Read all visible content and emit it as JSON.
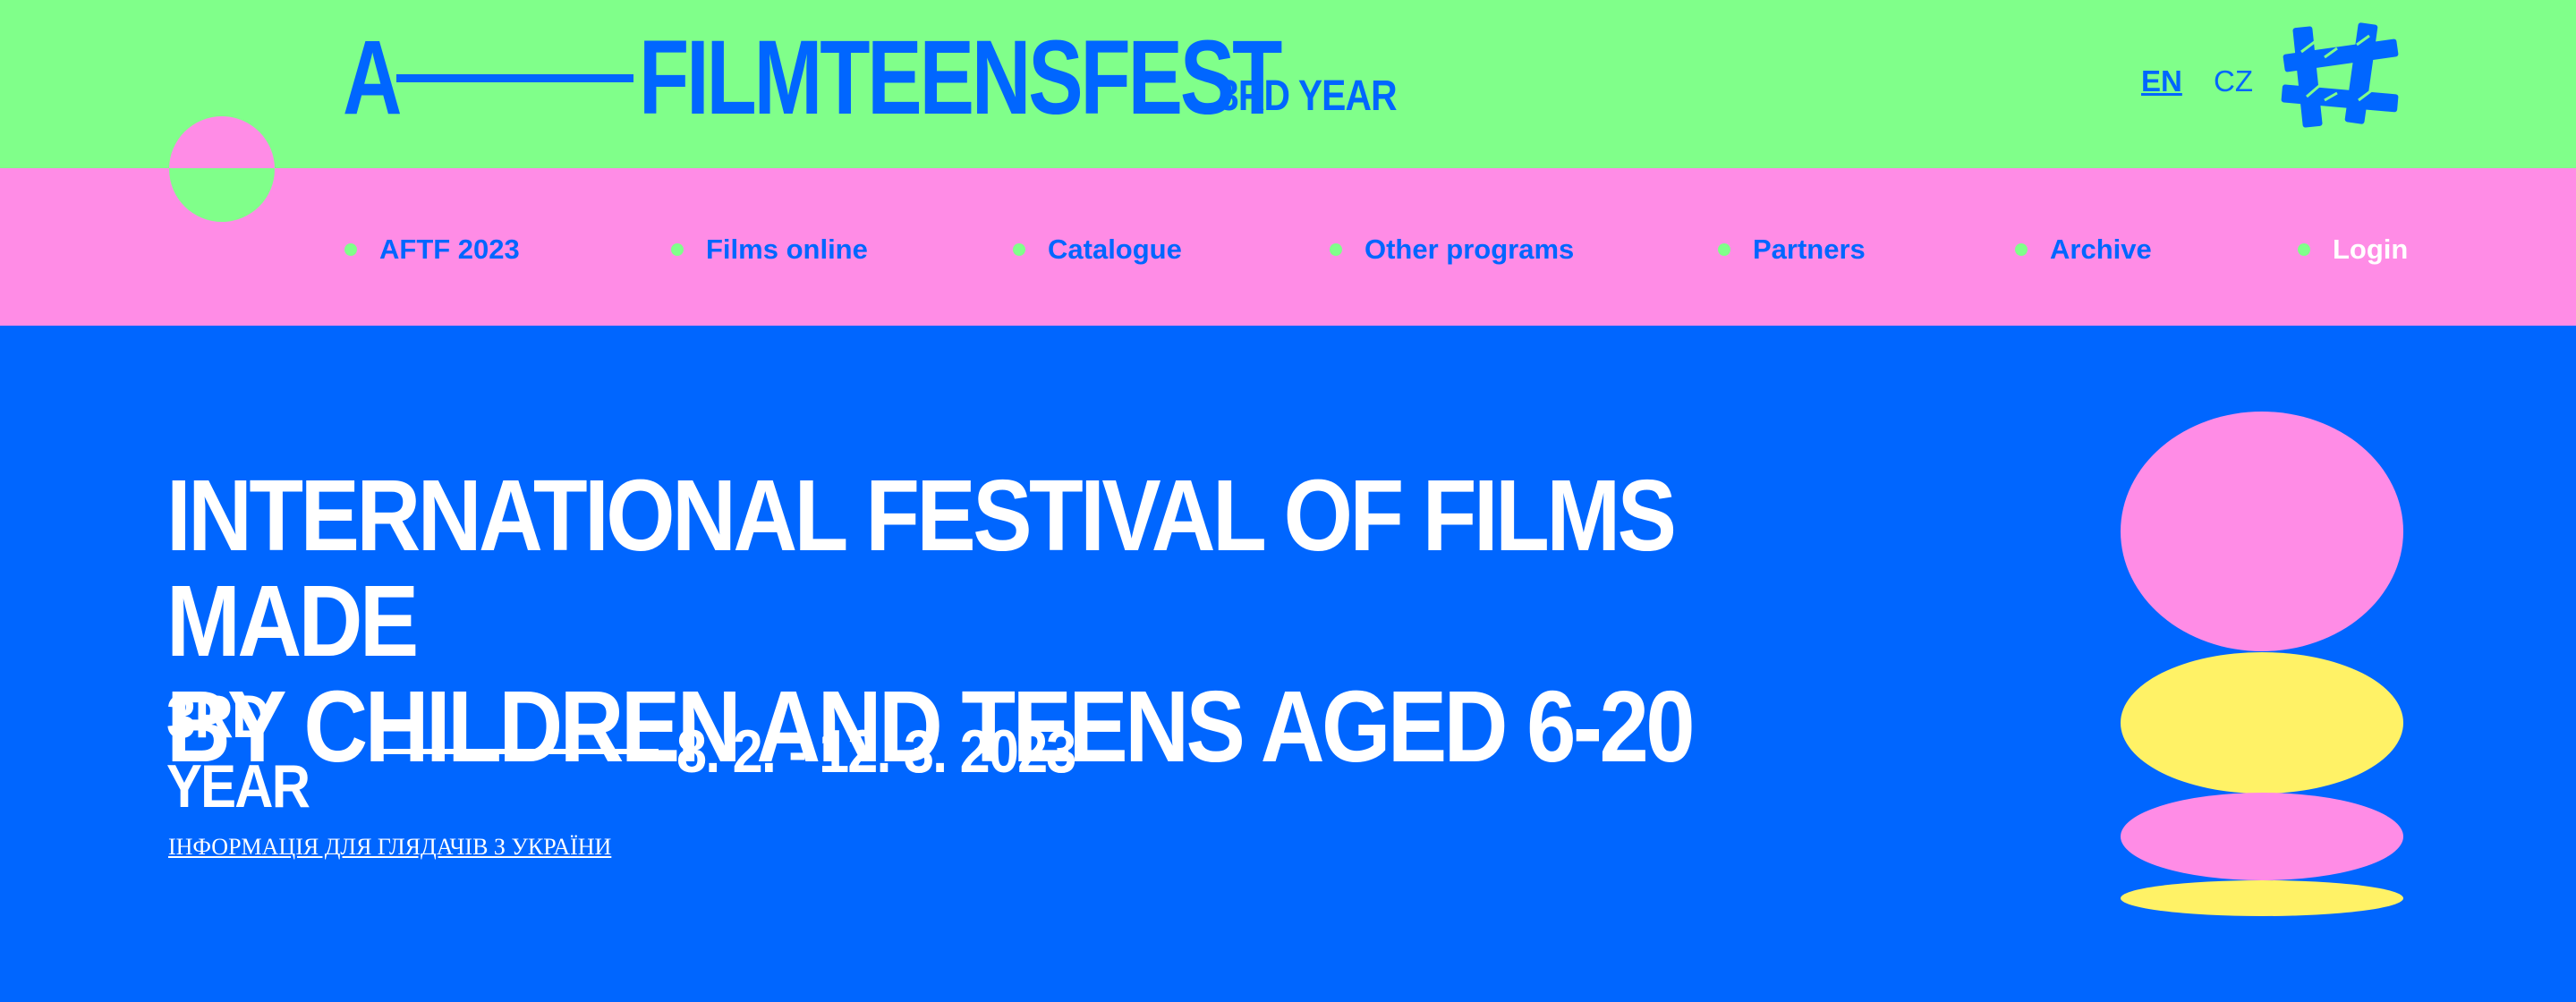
{
  "header": {
    "logo_a": "A",
    "logo_name": "FILMTEENSFEST",
    "year_tag": "3RD YEAR",
    "languages": [
      {
        "label": "EN",
        "active": true
      },
      {
        "label": "CZ",
        "active": false
      }
    ]
  },
  "nav": {
    "items": [
      {
        "label": "AFTF 2023"
      },
      {
        "label": "Films online"
      },
      {
        "label": "Catalogue"
      },
      {
        "label": "Other programs"
      },
      {
        "label": "Partners"
      },
      {
        "label": "Archive"
      },
      {
        "label": "Login"
      }
    ]
  },
  "hero": {
    "headline_line1": "INTERNATIONAL FESTIVAL OF FILMS MADE",
    "headline_line2": "BY CHILDREN AND TEENS AGED 6-20",
    "year": "3RD YEAR",
    "dates": "8. 2. - 12. 3. 2023",
    "ukraine_link": "ІНФОРМАЦІЯ ДЛЯ ГЛЯДАЧІВ З УКРАЇНИ"
  },
  "colors": {
    "blue": "#0066FF",
    "green": "#80FF8A",
    "pink": "#FF8CE6",
    "yellow": "#FFF266",
    "white": "#FFFFFF"
  },
  "icons": {
    "hash_logo": "hash-logo-icon",
    "nav_bullet": "dot-icon"
  }
}
